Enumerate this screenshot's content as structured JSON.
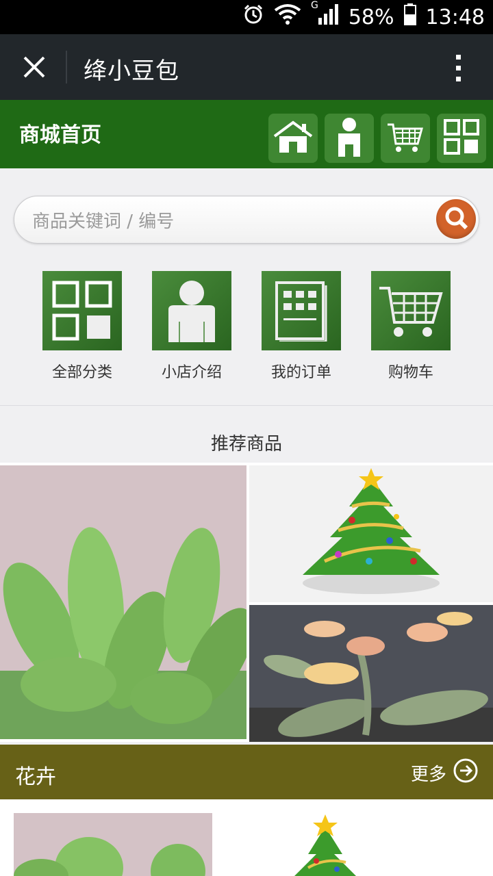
{
  "status_bar": {
    "network": "G",
    "battery": "58%",
    "time": "13:48",
    "icons": [
      "alarm-icon",
      "wifi-icon",
      "signal-icon",
      "battery-icon"
    ]
  },
  "title_bar": {
    "title": "绛小豆包",
    "icons": [
      "close-icon",
      "more-vertical-icon"
    ]
  },
  "shop_header": {
    "title": "商城首页",
    "buttons": [
      "home-icon",
      "user-icon",
      "cart-icon",
      "category-grid-icon"
    ],
    "bar_color": "#1f6a15"
  },
  "search": {
    "placeholder": "商品关键词 / 编号",
    "button_icon": "search-icon",
    "button_color": "#d2622a"
  },
  "categories": [
    {
      "label": "全部分类",
      "icon": "grid-icon"
    },
    {
      "label": "小店介绍",
      "icon": "person-icon"
    },
    {
      "label": "我的订单",
      "icon": "order-list-icon"
    },
    {
      "label": "购物车",
      "icon": "cart-icon"
    }
  ],
  "recommended": {
    "title": "推荐商品",
    "images": [
      "succulent-plant-image",
      "christmas-tree-image",
      "succulent-flower-image"
    ]
  },
  "section": {
    "title": "花卉",
    "more_label": "更多",
    "more_icon": "arrow-right-circle-icon",
    "bar_color": "#676117"
  },
  "section_images": [
    "succulent-plant-image",
    "christmas-tree-image"
  ]
}
